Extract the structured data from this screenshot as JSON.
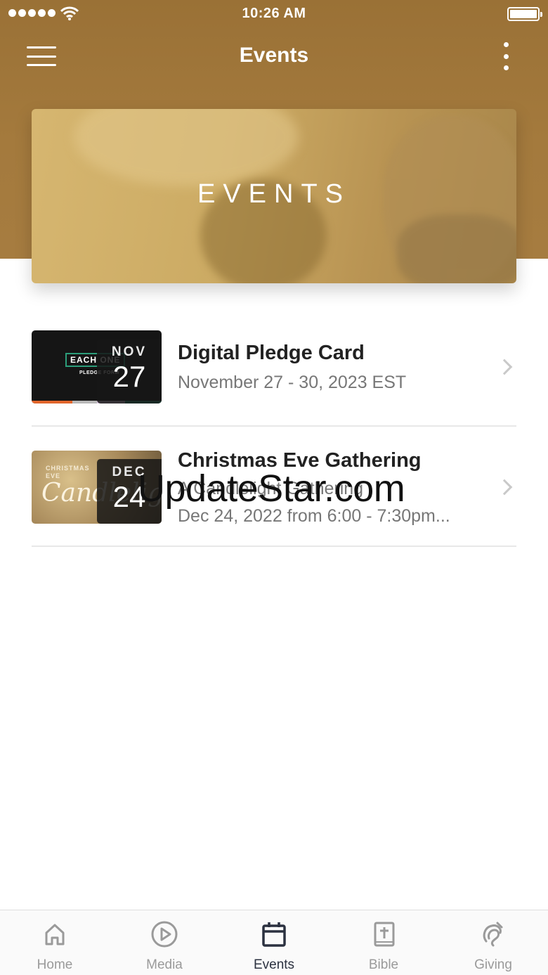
{
  "status_bar": {
    "time": "10:26 AM"
  },
  "nav": {
    "title": "Events"
  },
  "hero": {
    "title": "EVENTS"
  },
  "events": [
    {
      "title": "Digital Pledge Card",
      "subtitle": "November 27 - 30, 2023 EST",
      "month": "NOV",
      "day": "27",
      "thumb_tag": "EACH ONE",
      "thumb_sub": "PLEDGE FORM"
    },
    {
      "title": "Christmas Eve Gathering",
      "subtitle": "A Candlelight Gathering",
      "subtitle2": "Dec 24, 2022 from 6:00 - 7:30pm...",
      "month": "DEC",
      "day": "24",
      "thumb_tag": "CHRISTMAS EVE",
      "thumb_script": "Candlelight"
    }
  ],
  "watermark": "UpdateStar.com",
  "tabs": [
    {
      "label": "Home",
      "icon": "home-icon"
    },
    {
      "label": "Media",
      "icon": "play-circle-icon"
    },
    {
      "label": "Events",
      "icon": "calendar-icon",
      "active": true
    },
    {
      "label": "Bible",
      "icon": "bible-icon"
    },
    {
      "label": "Giving",
      "icon": "giving-icon"
    }
  ],
  "colors": {
    "header": "#a47a3d",
    "active_tab": "#2b3140",
    "inactive_tab": "#9a9a9a"
  }
}
